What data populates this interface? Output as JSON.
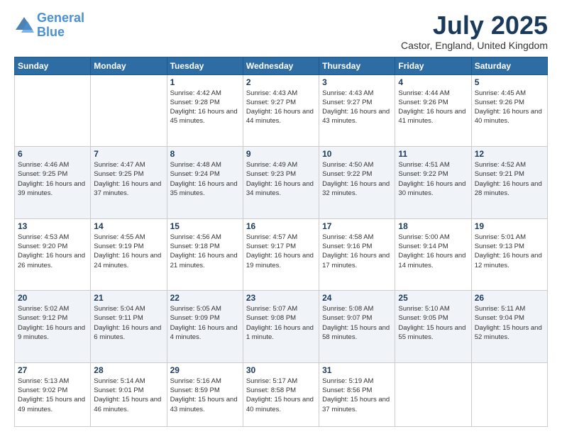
{
  "header": {
    "logo_line1": "General",
    "logo_line2": "Blue",
    "month": "July 2025",
    "location": "Castor, England, United Kingdom"
  },
  "weekdays": [
    "Sunday",
    "Monday",
    "Tuesday",
    "Wednesday",
    "Thursday",
    "Friday",
    "Saturday"
  ],
  "weeks": [
    [
      {
        "day": "",
        "info": ""
      },
      {
        "day": "",
        "info": ""
      },
      {
        "day": "1",
        "info": "Sunrise: 4:42 AM\nSunset: 9:28 PM\nDaylight: 16 hours and 45 minutes."
      },
      {
        "day": "2",
        "info": "Sunrise: 4:43 AM\nSunset: 9:27 PM\nDaylight: 16 hours and 44 minutes."
      },
      {
        "day": "3",
        "info": "Sunrise: 4:43 AM\nSunset: 9:27 PM\nDaylight: 16 hours and 43 minutes."
      },
      {
        "day": "4",
        "info": "Sunrise: 4:44 AM\nSunset: 9:26 PM\nDaylight: 16 hours and 41 minutes."
      },
      {
        "day": "5",
        "info": "Sunrise: 4:45 AM\nSunset: 9:26 PM\nDaylight: 16 hours and 40 minutes."
      }
    ],
    [
      {
        "day": "6",
        "info": "Sunrise: 4:46 AM\nSunset: 9:25 PM\nDaylight: 16 hours and 39 minutes."
      },
      {
        "day": "7",
        "info": "Sunrise: 4:47 AM\nSunset: 9:25 PM\nDaylight: 16 hours and 37 minutes."
      },
      {
        "day": "8",
        "info": "Sunrise: 4:48 AM\nSunset: 9:24 PM\nDaylight: 16 hours and 35 minutes."
      },
      {
        "day": "9",
        "info": "Sunrise: 4:49 AM\nSunset: 9:23 PM\nDaylight: 16 hours and 34 minutes."
      },
      {
        "day": "10",
        "info": "Sunrise: 4:50 AM\nSunset: 9:22 PM\nDaylight: 16 hours and 32 minutes."
      },
      {
        "day": "11",
        "info": "Sunrise: 4:51 AM\nSunset: 9:22 PM\nDaylight: 16 hours and 30 minutes."
      },
      {
        "day": "12",
        "info": "Sunrise: 4:52 AM\nSunset: 9:21 PM\nDaylight: 16 hours and 28 minutes."
      }
    ],
    [
      {
        "day": "13",
        "info": "Sunrise: 4:53 AM\nSunset: 9:20 PM\nDaylight: 16 hours and 26 minutes."
      },
      {
        "day": "14",
        "info": "Sunrise: 4:55 AM\nSunset: 9:19 PM\nDaylight: 16 hours and 24 minutes."
      },
      {
        "day": "15",
        "info": "Sunrise: 4:56 AM\nSunset: 9:18 PM\nDaylight: 16 hours and 21 minutes."
      },
      {
        "day": "16",
        "info": "Sunrise: 4:57 AM\nSunset: 9:17 PM\nDaylight: 16 hours and 19 minutes."
      },
      {
        "day": "17",
        "info": "Sunrise: 4:58 AM\nSunset: 9:16 PM\nDaylight: 16 hours and 17 minutes."
      },
      {
        "day": "18",
        "info": "Sunrise: 5:00 AM\nSunset: 9:14 PM\nDaylight: 16 hours and 14 minutes."
      },
      {
        "day": "19",
        "info": "Sunrise: 5:01 AM\nSunset: 9:13 PM\nDaylight: 16 hours and 12 minutes."
      }
    ],
    [
      {
        "day": "20",
        "info": "Sunrise: 5:02 AM\nSunset: 9:12 PM\nDaylight: 16 hours and 9 minutes."
      },
      {
        "day": "21",
        "info": "Sunrise: 5:04 AM\nSunset: 9:11 PM\nDaylight: 16 hours and 6 minutes."
      },
      {
        "day": "22",
        "info": "Sunrise: 5:05 AM\nSunset: 9:09 PM\nDaylight: 16 hours and 4 minutes."
      },
      {
        "day": "23",
        "info": "Sunrise: 5:07 AM\nSunset: 9:08 PM\nDaylight: 16 hours and 1 minute."
      },
      {
        "day": "24",
        "info": "Sunrise: 5:08 AM\nSunset: 9:07 PM\nDaylight: 15 hours and 58 minutes."
      },
      {
        "day": "25",
        "info": "Sunrise: 5:10 AM\nSunset: 9:05 PM\nDaylight: 15 hours and 55 minutes."
      },
      {
        "day": "26",
        "info": "Sunrise: 5:11 AM\nSunset: 9:04 PM\nDaylight: 15 hours and 52 minutes."
      }
    ],
    [
      {
        "day": "27",
        "info": "Sunrise: 5:13 AM\nSunset: 9:02 PM\nDaylight: 15 hours and 49 minutes."
      },
      {
        "day": "28",
        "info": "Sunrise: 5:14 AM\nSunset: 9:01 PM\nDaylight: 15 hours and 46 minutes."
      },
      {
        "day": "29",
        "info": "Sunrise: 5:16 AM\nSunset: 8:59 PM\nDaylight: 15 hours and 43 minutes."
      },
      {
        "day": "30",
        "info": "Sunrise: 5:17 AM\nSunset: 8:58 PM\nDaylight: 15 hours and 40 minutes."
      },
      {
        "day": "31",
        "info": "Sunrise: 5:19 AM\nSunset: 8:56 PM\nDaylight: 15 hours and 37 minutes."
      },
      {
        "day": "",
        "info": ""
      },
      {
        "day": "",
        "info": ""
      }
    ]
  ]
}
